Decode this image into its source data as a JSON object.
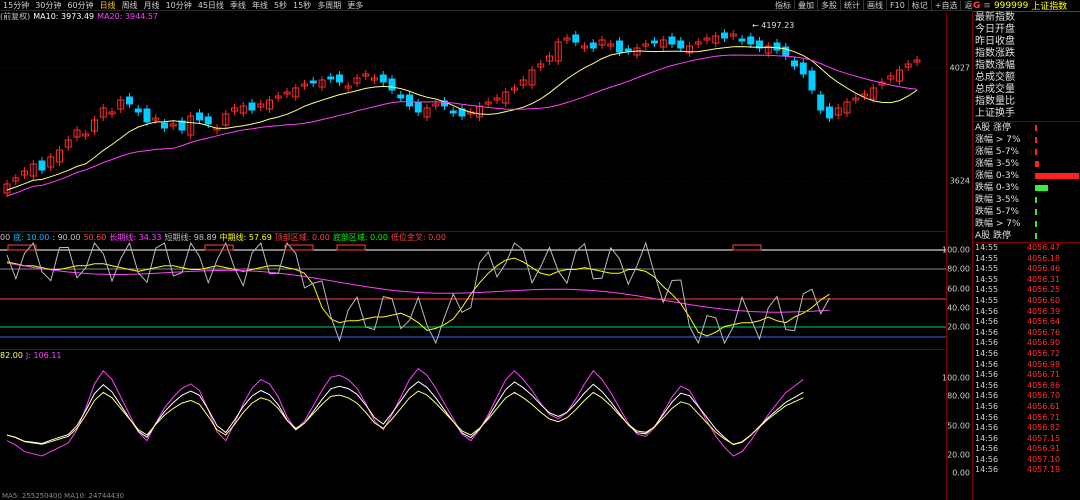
{
  "toolbar": {
    "periods": [
      "15分钟",
      "30分钟",
      "60分钟",
      "日线",
      "周线",
      "月线",
      "10分钟",
      "45日线",
      "季线",
      "年线",
      "5秒",
      "15秒",
      "多周期",
      "更多"
    ],
    "active_period": "日线",
    "tools": [
      "指标",
      "叠加",
      "多股",
      "统计",
      "画线",
      "F10",
      "标记",
      "+自选",
      "返回"
    ]
  },
  "kline": {
    "legend": [
      {
        "text": "(前复权)",
        "color": "#c0c0c0"
      },
      {
        "text": "MA10: 3973.49",
        "color": "#ffffff"
      },
      {
        "text": "MA20: 3944.57",
        "color": "#ff40ff"
      }
    ],
    "high_label": "4197.23",
    "axis_labels": [
      "4027",
      "3624"
    ],
    "up_color": "#ff2a2a",
    "down_color": "#00ccff",
    "ma10_color": "#ffff80",
    "ma20_color": "#ff40ff"
  },
  "ind1": {
    "legend": [
      {
        "text": "00",
        "color": "#c0c0c0"
      },
      {
        "text": "底: 10.00",
        "color": "#00c0ff"
      },
      {
        "text": ": 90.00",
        "color": "#c0c0c0"
      },
      {
        "text": "50.60",
        "color": "#ff4040"
      },
      {
        "text": "长期线: 34.33",
        "color": "#ff40ff"
      },
      {
        "text": "短期线: 98.89",
        "color": "#c0c0c0"
      },
      {
        "text": "中期线: 57.69",
        "color": "#ffff00"
      },
      {
        "text": "顶部区域: 0.00",
        "color": "#ff4040"
      },
      {
        "text": "底部区域: 0.00",
        "color": "#00ff00"
      },
      {
        "text": "低位金叉: 0.00",
        "color": "#ff4040"
      }
    ],
    "axis_labels": [
      "100.00",
      "80.00",
      "60.00",
      "40.00",
      "20.00"
    ]
  },
  "ind2": {
    "legend": [
      {
        "text": "82.00",
        "color": "#ffff80"
      },
      {
        "text": "J: 106.11",
        "color": "#ff40ff"
      }
    ],
    "axis_labels": [
      "100.00",
      "80.00",
      "50.00",
      "20.00",
      "0.00"
    ],
    "bottom_text": "MA5: 255250400 MA10: 24744430"
  },
  "right": {
    "g": "G",
    "menu": "≡",
    "code": "999999",
    "name": "上证指数",
    "info": [
      "最新指数",
      "今日开盘",
      "昨日收盘",
      "指数涨跌",
      "指数涨幅",
      "总成交额",
      "总成交量",
      "指数量比",
      "上证换手"
    ],
    "dist": [
      {
        "label": "A股 涨停",
        "bar": 0.02,
        "color": "#ff2020"
      },
      {
        "label": "涨幅 > 7%",
        "bar": 0.03,
        "color": "#ff2020"
      },
      {
        "label": "涨幅 5-7%",
        "bar": 0.04,
        "color": "#ff2020"
      },
      {
        "label": "涨幅 3-5%",
        "bar": 0.1,
        "color": "#ff2020"
      },
      {
        "label": "涨幅 0-3%",
        "bar": 1.0,
        "color": "#ff2020"
      },
      {
        "label": "跌幅 0-3%",
        "bar": 0.3,
        "color": "#33ee33"
      },
      {
        "label": "跌幅 3-5%",
        "bar": 0.015,
        "color": "#33ee33"
      },
      {
        "label": "跌幅 5-7%",
        "bar": 0.01,
        "color": "#33ee33"
      },
      {
        "label": "跌幅 > 7%",
        "bar": 0.01,
        "color": "#33ee33"
      },
      {
        "label": "A股 跌停",
        "bar": 0.01,
        "color": "#33ee33"
      }
    ],
    "trades": [
      {
        "time": "14:55",
        "price": "4056.47"
      },
      {
        "time": "14:55",
        "price": "4056.18"
      },
      {
        "time": "14:55",
        "price": "4056.46"
      },
      {
        "time": "14:55",
        "price": "4056.31"
      },
      {
        "time": "14:55",
        "price": "4056.25"
      },
      {
        "time": "14:55",
        "price": "4056.60"
      },
      {
        "time": "14:56",
        "price": "4056.39"
      },
      {
        "time": "14:56",
        "price": "4056.64"
      },
      {
        "time": "14:56",
        "price": "4056.76"
      },
      {
        "time": "14:56",
        "price": "4056.90"
      },
      {
        "time": "14:56",
        "price": "4056.72"
      },
      {
        "time": "14:56",
        "price": "4056.98"
      },
      {
        "time": "14:56",
        "price": "4056.71"
      },
      {
        "time": "14:56",
        "price": "4056.86"
      },
      {
        "time": "14:56",
        "price": "4056.70"
      },
      {
        "time": "14:56",
        "price": "4056.61"
      },
      {
        "time": "14:56",
        "price": "4056.71"
      },
      {
        "time": "14:56",
        "price": "4056.82"
      },
      {
        "time": "14:56",
        "price": "4057.15"
      },
      {
        "time": "14:56",
        "price": "4056.91"
      },
      {
        "time": "14:56",
        "price": "4057.10"
      },
      {
        "time": "14:56",
        "price": "4057.18"
      }
    ]
  }
}
